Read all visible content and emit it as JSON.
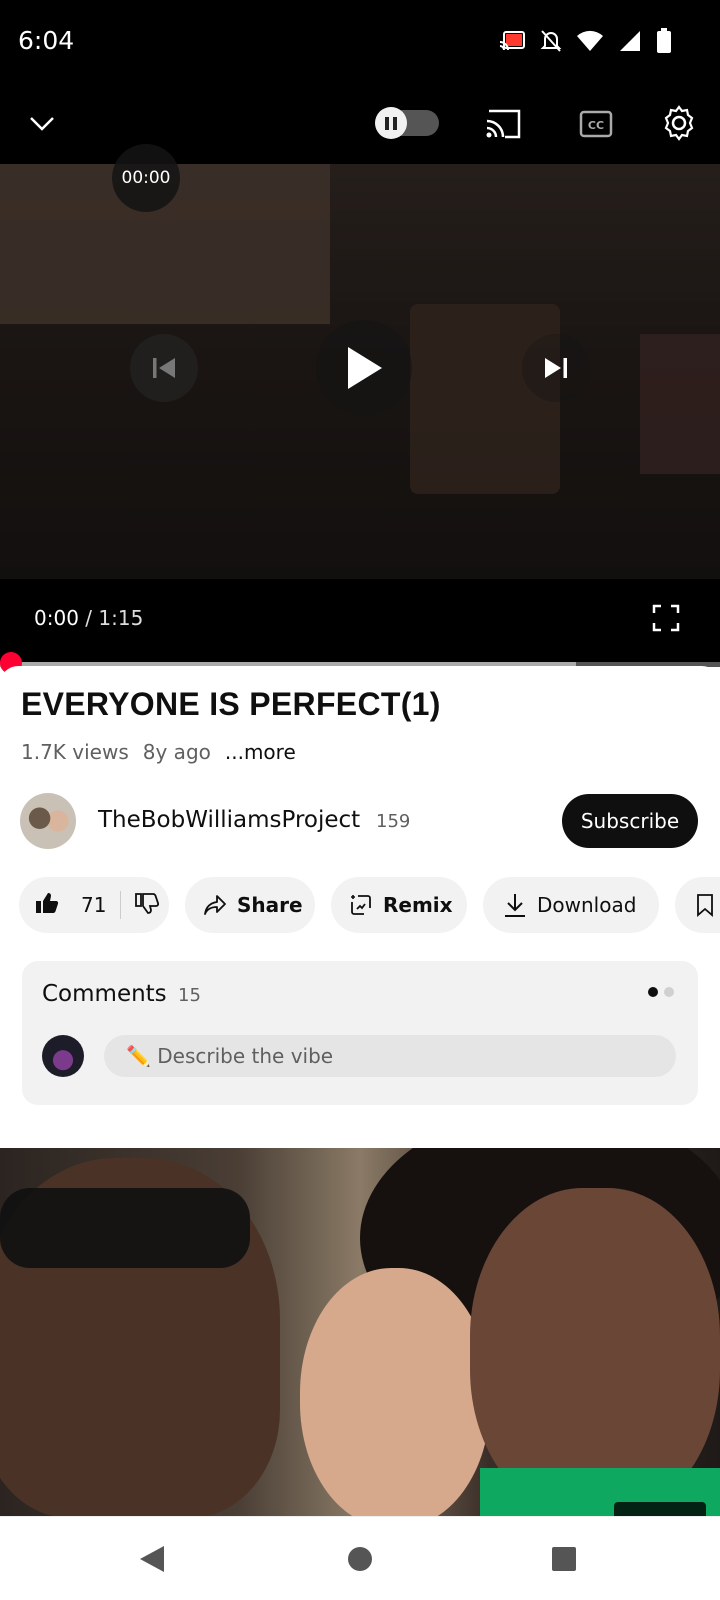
{
  "status_bar": {
    "time": "6:04",
    "icons": [
      "cast-icon",
      "mute-icon",
      "wifi-icon",
      "signal-icon",
      "battery-icon"
    ]
  },
  "player": {
    "seek_bubble": "00:00",
    "current_time": "0:00",
    "separator": " / ",
    "duration": "1:15",
    "progress_fraction": 0.0,
    "buffered_fraction": 0.8,
    "accent_color": "#ff0033",
    "controls": [
      "minimize-chevron-icon",
      "autoplay-toggle",
      "cast-icon",
      "captions-icon",
      "settings-gear-icon",
      "previous-icon",
      "play-icon",
      "next-icon",
      "fullscreen-icon"
    ]
  },
  "video": {
    "title": "EVERYONE IS PERFECT(1)",
    "views": "1.7K views",
    "age": "8y ago",
    "more_label": "...more"
  },
  "channel": {
    "name": "TheBobWilliamsProject",
    "subscribers": "159",
    "subscribe_label": "Subscribe"
  },
  "actions": {
    "likes": "71",
    "share_label": "Share",
    "remix_label": "Remix",
    "download_label": "Download"
  },
  "comments": {
    "title": "Comments",
    "count": "15",
    "placeholder": "✏️ Describe the vibe"
  }
}
